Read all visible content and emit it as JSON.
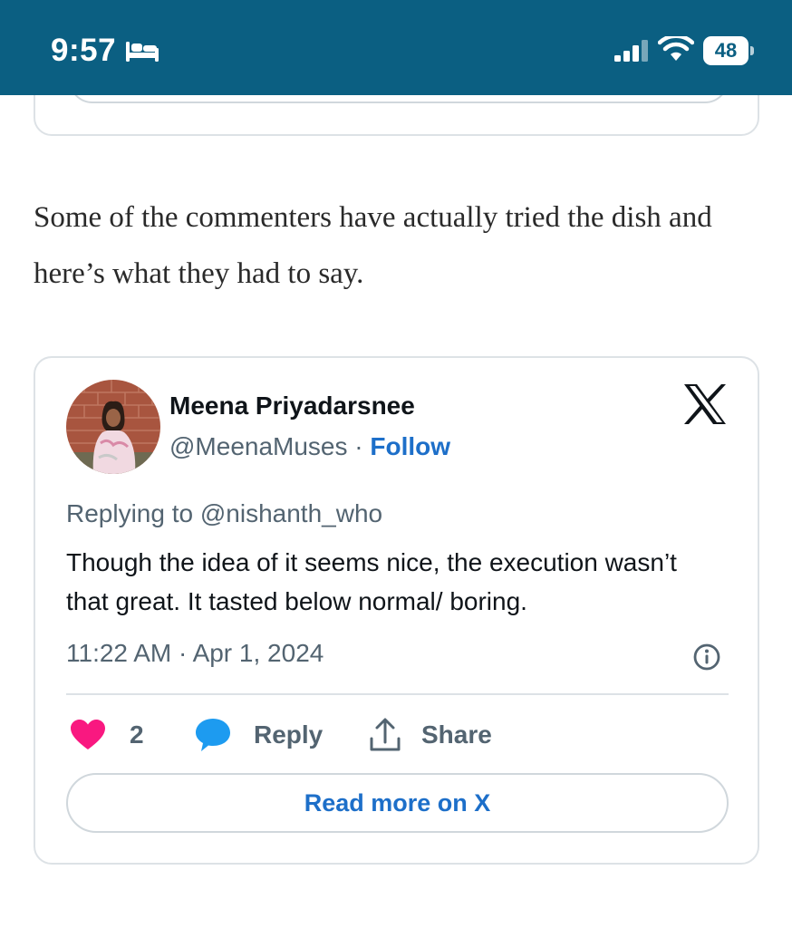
{
  "status_bar": {
    "time": "9:57",
    "battery_level": "48",
    "icons": [
      "bed-icon",
      "signal-icon",
      "wifi-icon",
      "battery-icon"
    ],
    "background_color": "#0b5f82"
  },
  "article": {
    "paragraph": "Some of the commenters have actually tried the dish and here’s what they had to say."
  },
  "tweet": {
    "display_name": "Meena Priyadarsnee",
    "handle": "@MeenaMuses",
    "separator": " · ",
    "follow_label": "Follow",
    "replying_to": "Replying to @nishanth_who",
    "text": "Though the idea of it seems nice, the execution wasn’t that great. It tasted below normal/ boring.",
    "timestamp": "11:22 AM · Apr 1, 2024",
    "like_count": "2",
    "reply_label": "Reply",
    "share_label": "Share",
    "read_more_label": "Read more on X",
    "colors": {
      "link": "#1d6fc9",
      "like": "#f91880",
      "reply_bubble": "#1d9bf0",
      "secondary_text": "#536471"
    }
  }
}
